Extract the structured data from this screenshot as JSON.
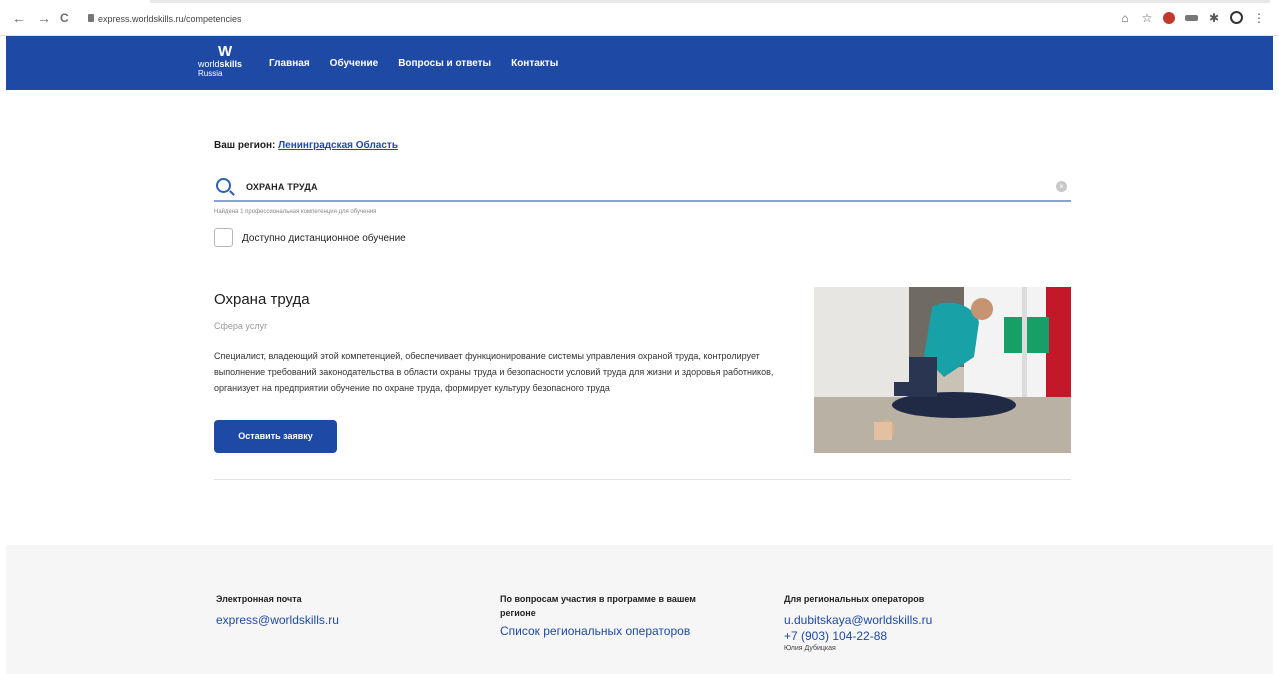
{
  "browser": {
    "nav_back": "←",
    "nav_forward": "→",
    "nav_reload": "C",
    "url": "express.worldskills.ru/competencies",
    "ext_icons": [
      "translate-icon",
      "star-icon",
      "extension-face-icon",
      "extension-bar-icon",
      "puzzle-icon",
      "profile-icon",
      "menu-icon"
    ]
  },
  "header": {
    "logo": {
      "mark": "W",
      "word_light": "world",
      "word_bold": "skills",
      "country": "Russia"
    },
    "nav": [
      "Главная",
      "Обучение",
      "Вопросы и ответы",
      "Контакты"
    ],
    "bg_color": "#1e4aa6"
  },
  "region": {
    "label": "Ваш регион:",
    "value": "Ленинградская Область"
  },
  "search": {
    "value": "ОХРАНА ТРУДА",
    "clear": "×"
  },
  "found_text": "Найдена 1 профессиональная компетенция для обучения",
  "remote_checkbox": {
    "label": "Доступно дистанционное обучение",
    "checked": false
  },
  "card": {
    "title": "Охрана труда",
    "subtitle": "Сфера услуг",
    "description": "Специалист, владеющий этой компетенцией, обеспечивает функционирование системы управления охраной труда, контролирует выполнение требований законодательства в области охраны труда и безопасности условий труда для жизни и здоровья работников, организует на предприятии обучение по охране труда, формирует культуру безопасного труда",
    "button": "Оставить заявку"
  },
  "footer": {
    "email": {
      "heading": "Электронная почта",
      "value": "express@worldskills.ru"
    },
    "participation": {
      "heading": "По вопросам участия в программе в вашем регионе",
      "link": "Список региональных операторов"
    },
    "operators": {
      "heading": "Для региональных операторов",
      "email": "u.dubitskaya@worldskills.ru",
      "phone": "+7 (903) 104-22-88",
      "name": "Юлия Дубицкая"
    }
  }
}
